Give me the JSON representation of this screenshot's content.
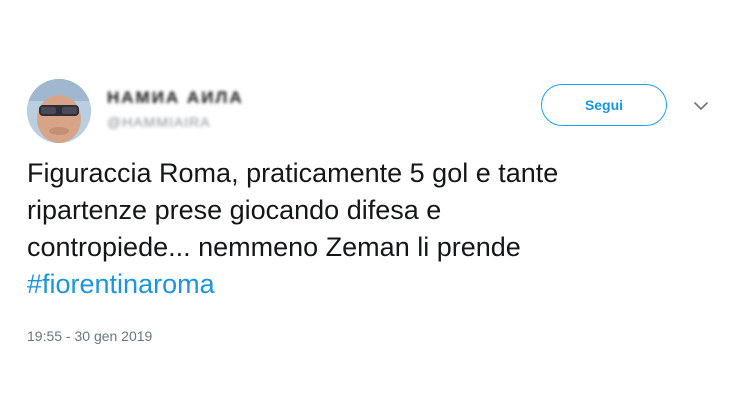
{
  "author": {
    "display_name": "НАМИА АИЛА",
    "handle": "@HAMMIAIRA"
  },
  "follow_button": {
    "label": "Segui"
  },
  "tweet": {
    "lines": [
      "Figuraccia Roma, praticamente 5 gol e tante",
      "ripartenze prese giocando difesa e",
      "contropiede... nemmeno Zeman li prende"
    ],
    "hashtag": "#fiorentinaroma",
    "timestamp": "19:55 - 30 gen 2019"
  },
  "icons": {
    "avatar": "avatar-image",
    "caret": "chevron-down-icon"
  },
  "colors": {
    "link": "#1b95e0",
    "follow_border": "#1da1f2",
    "text": "#14171a",
    "muted": "#657786"
  }
}
